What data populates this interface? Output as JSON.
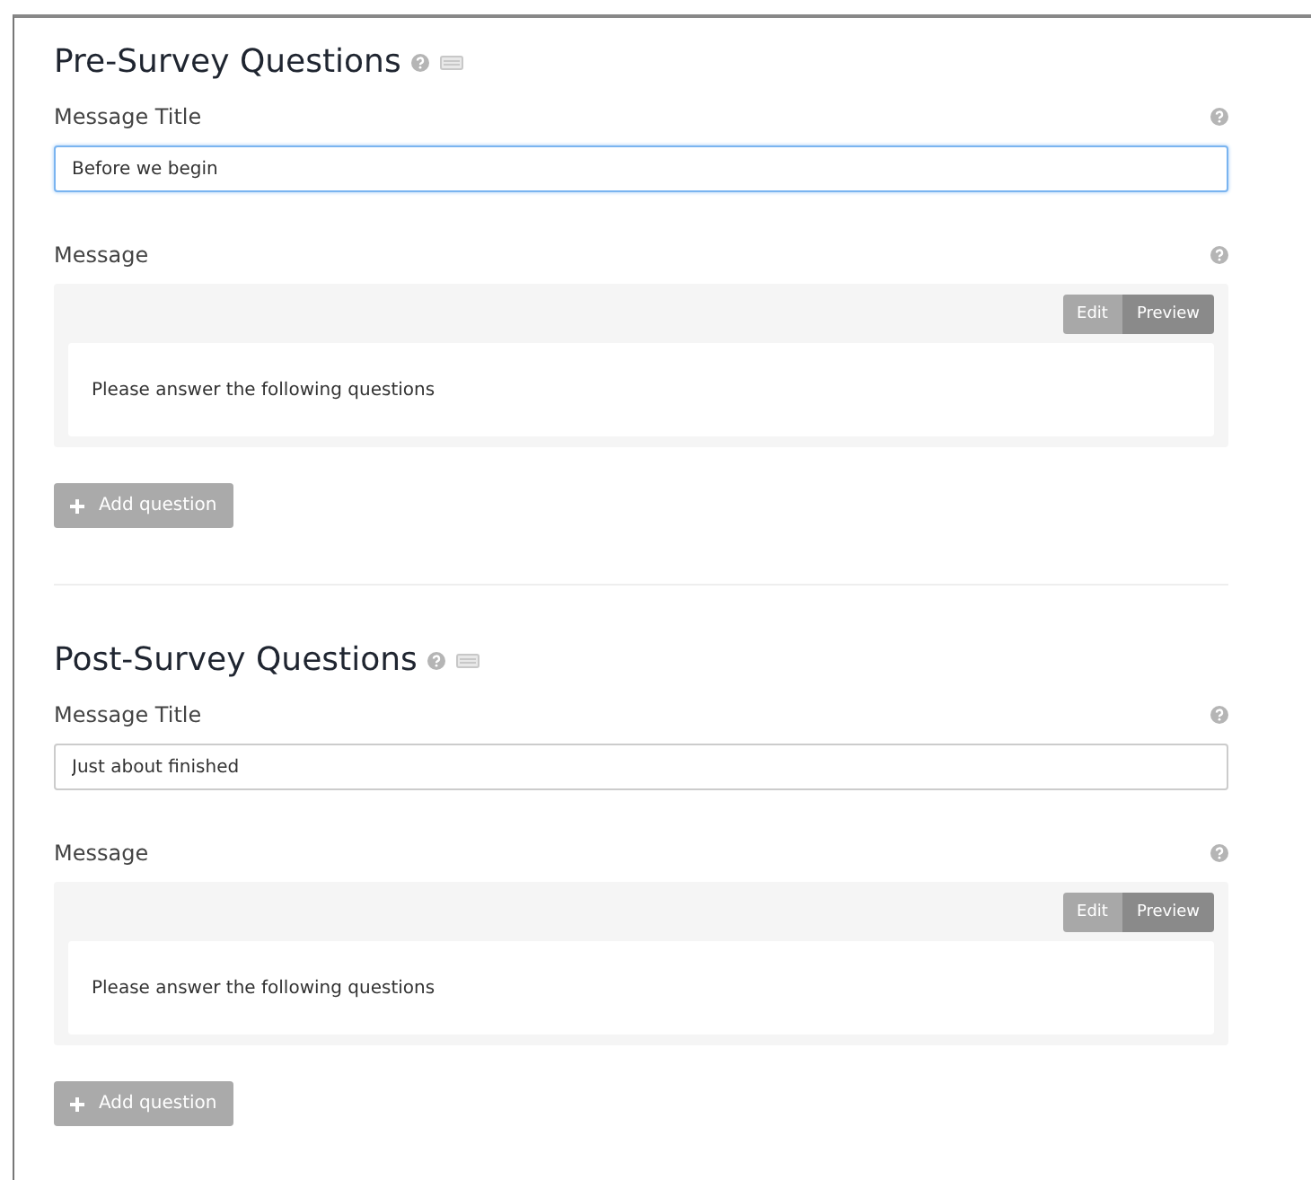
{
  "sections": [
    {
      "title": "Pre-Survey Questions",
      "title_field": {
        "label": "Message Title",
        "value": "Before we begin",
        "focused": true
      },
      "message": {
        "label": "Message",
        "modes": [
          {
            "label": "Edit",
            "selected": false
          },
          {
            "label": "Preview",
            "selected": true
          }
        ],
        "body": "Please answer the following questions"
      },
      "add_button": "Add question"
    },
    {
      "title": "Post-Survey Questions",
      "title_field": {
        "label": "Message Title",
        "value": "Just about finished",
        "focused": false
      },
      "message": {
        "label": "Message",
        "modes": [
          {
            "label": "Edit",
            "selected": false
          },
          {
            "label": "Preview",
            "selected": true
          }
        ],
        "body": "Please answer the following questions"
      },
      "add_button": "Add question"
    }
  ]
}
